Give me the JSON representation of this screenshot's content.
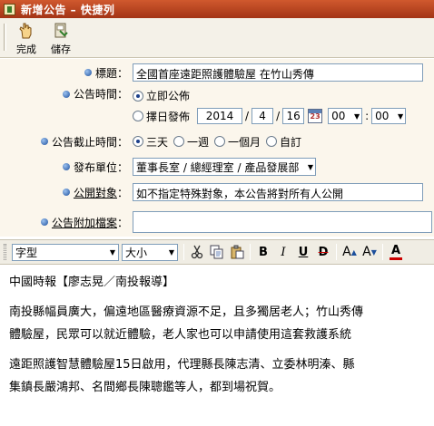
{
  "window": {
    "title": "新增公告 – 快捷列",
    "icon": "app-icon"
  },
  "toolbar": {
    "done_label": "完成",
    "save_label": "儲存"
  },
  "form": {
    "title_label": "標題：",
    "title_value": "全國首座遠距照護體驗屋 在竹山秀傳",
    "publish_time_label": "公告時間：",
    "publish_now_label": "立即公佈",
    "publish_date_label": "擇日發佈",
    "year": "2014",
    "month": "4",
    "day": "16",
    "hour": "00",
    "minute": "00",
    "deadline_label": "公告截止時間：",
    "deadline_options": [
      "三天",
      "一週",
      "一個月",
      "自訂"
    ],
    "unit_label": "發布單位：",
    "unit_value": "董事長室 / 總經理室 / 產品發展部",
    "target_label": "公開對象",
    "target_suffix": "：",
    "target_value": "如不指定特殊對象，本公告將對所有人公開",
    "attach_label": "公告附加檔案",
    "attach_suffix": "："
  },
  "editor_toolbar": {
    "font_label": "字型",
    "size_label": "大小",
    "bold": "B",
    "italic": "I",
    "underline": "U",
    "strike": "D",
    "grow": "A",
    "shrink": "A",
    "color": "A"
  },
  "content": {
    "p1": "中國時報【廖志晃／南投報導】",
    "p2a": "南投縣幅員廣大，偏遠地區醫療資源不足，且多獨居老人；竹山秀傳",
    "p2b": "體驗屋，民眾可以就近體驗，老人家也可以申請使用這套救護系統",
    "p3a": "遠距照護智慧體驗屋15日啟用，代理縣長陳志清、立委林明溱、縣",
    "p3b": "集鎮長嚴鴻邦、名間鄉長陳聰鑑等人，都到場祝賀。"
  }
}
